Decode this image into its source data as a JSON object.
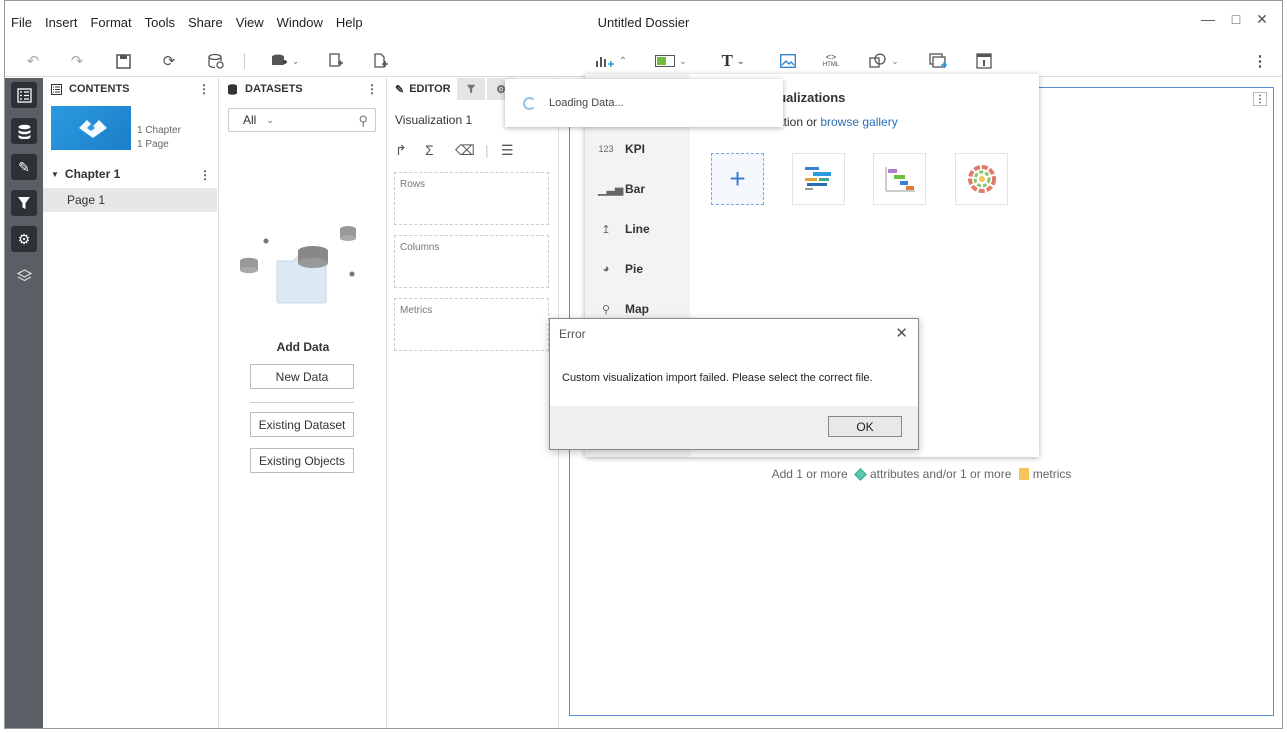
{
  "menu": [
    "File",
    "Insert",
    "Format",
    "Tools",
    "Share",
    "View",
    "Window",
    "Help"
  ],
  "window_title": "Untitled Dossier",
  "contents": {
    "header": "CONTENTS",
    "thumb_chapters": "1 Chapter",
    "thumb_pages": "1 Page",
    "chapter": "Chapter 1",
    "page": "Page 1"
  },
  "datasets": {
    "header": "DATASETS",
    "filter_value": "All",
    "add_data_title": "Add Data",
    "new_data": "New Data",
    "existing_dataset": "Existing Dataset",
    "existing_objects": "Existing Objects"
  },
  "editor": {
    "tab": "EDITOR",
    "viz_name": "Visualization 1",
    "rows": "Rows",
    "columns": "Columns",
    "metrics": "Metrics"
  },
  "gallery": {
    "title_partial": "sualizations",
    "subtitle_partial": "zation or ",
    "browse_link": "browse gallery",
    "types": [
      "KPI",
      "Bar",
      "Line",
      "Pie",
      "Map"
    ]
  },
  "loading": {
    "text": "Loading Data..."
  },
  "canvas": {
    "hint_1": "Add 1 or more",
    "hint_2": "attributes and/or 1 or more",
    "hint_3": "metrics"
  },
  "error_dialog": {
    "title": "Error",
    "message": "Custom visualization import failed. Please select the correct file.",
    "ok": "OK"
  },
  "colors": {
    "rail": "#5a5f66",
    "accent_blue": "#2a9be0",
    "frame_border": "#5b8dd6"
  }
}
